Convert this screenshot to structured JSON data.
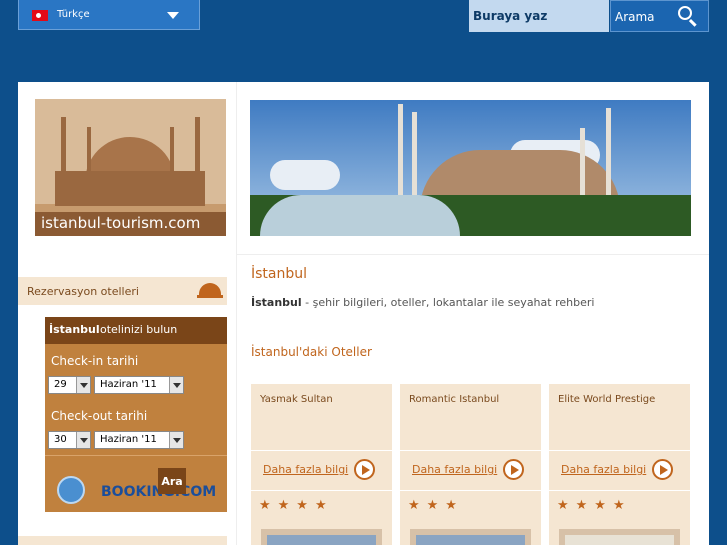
{
  "language": {
    "label": "Türkçe",
    "flag": "turkey-flag-icon"
  },
  "search": {
    "placeholder": "Buraya yaz",
    "button_label": "Arama"
  },
  "logo": {
    "text": "istanbul-tourism.com"
  },
  "sidebar": {
    "reservation_label": "Rezervasyon otelleri",
    "booking": {
      "heading_bold": "İstanbul",
      "heading_rest": "otelinizi bulun",
      "checkin_label": "Check-in tarihi",
      "checkin_day": "29",
      "checkin_month": "Haziran '11",
      "checkout_label": "Check-out tarihi",
      "checkout_day": "30",
      "checkout_month": "Haziran '11",
      "search_button": "Ara",
      "provider": "BOOKING.COM"
    }
  },
  "main": {
    "title": "İstanbul",
    "desc_bold": "İstanbul",
    "desc_rest": " - şehir bilgileri, oteller, lokantalar ile seyahat rehberi",
    "hotels_title": "İstanbul'daki Oteller",
    "hotels": [
      {
        "name": "Yasmak Sultan",
        "more": "Daha fazla bilgi",
        "stars": 4
      },
      {
        "name": "Romantic Istanbul",
        "more": "Daha fazla bilgi",
        "stars": 3
      },
      {
        "name": "Elite World Prestige",
        "more": "Daha fazla bilgi",
        "stars": 4
      }
    ]
  },
  "colors": {
    "background": "#0d4f8b",
    "accent": "#c0651d",
    "card": "#f5e6d2"
  }
}
